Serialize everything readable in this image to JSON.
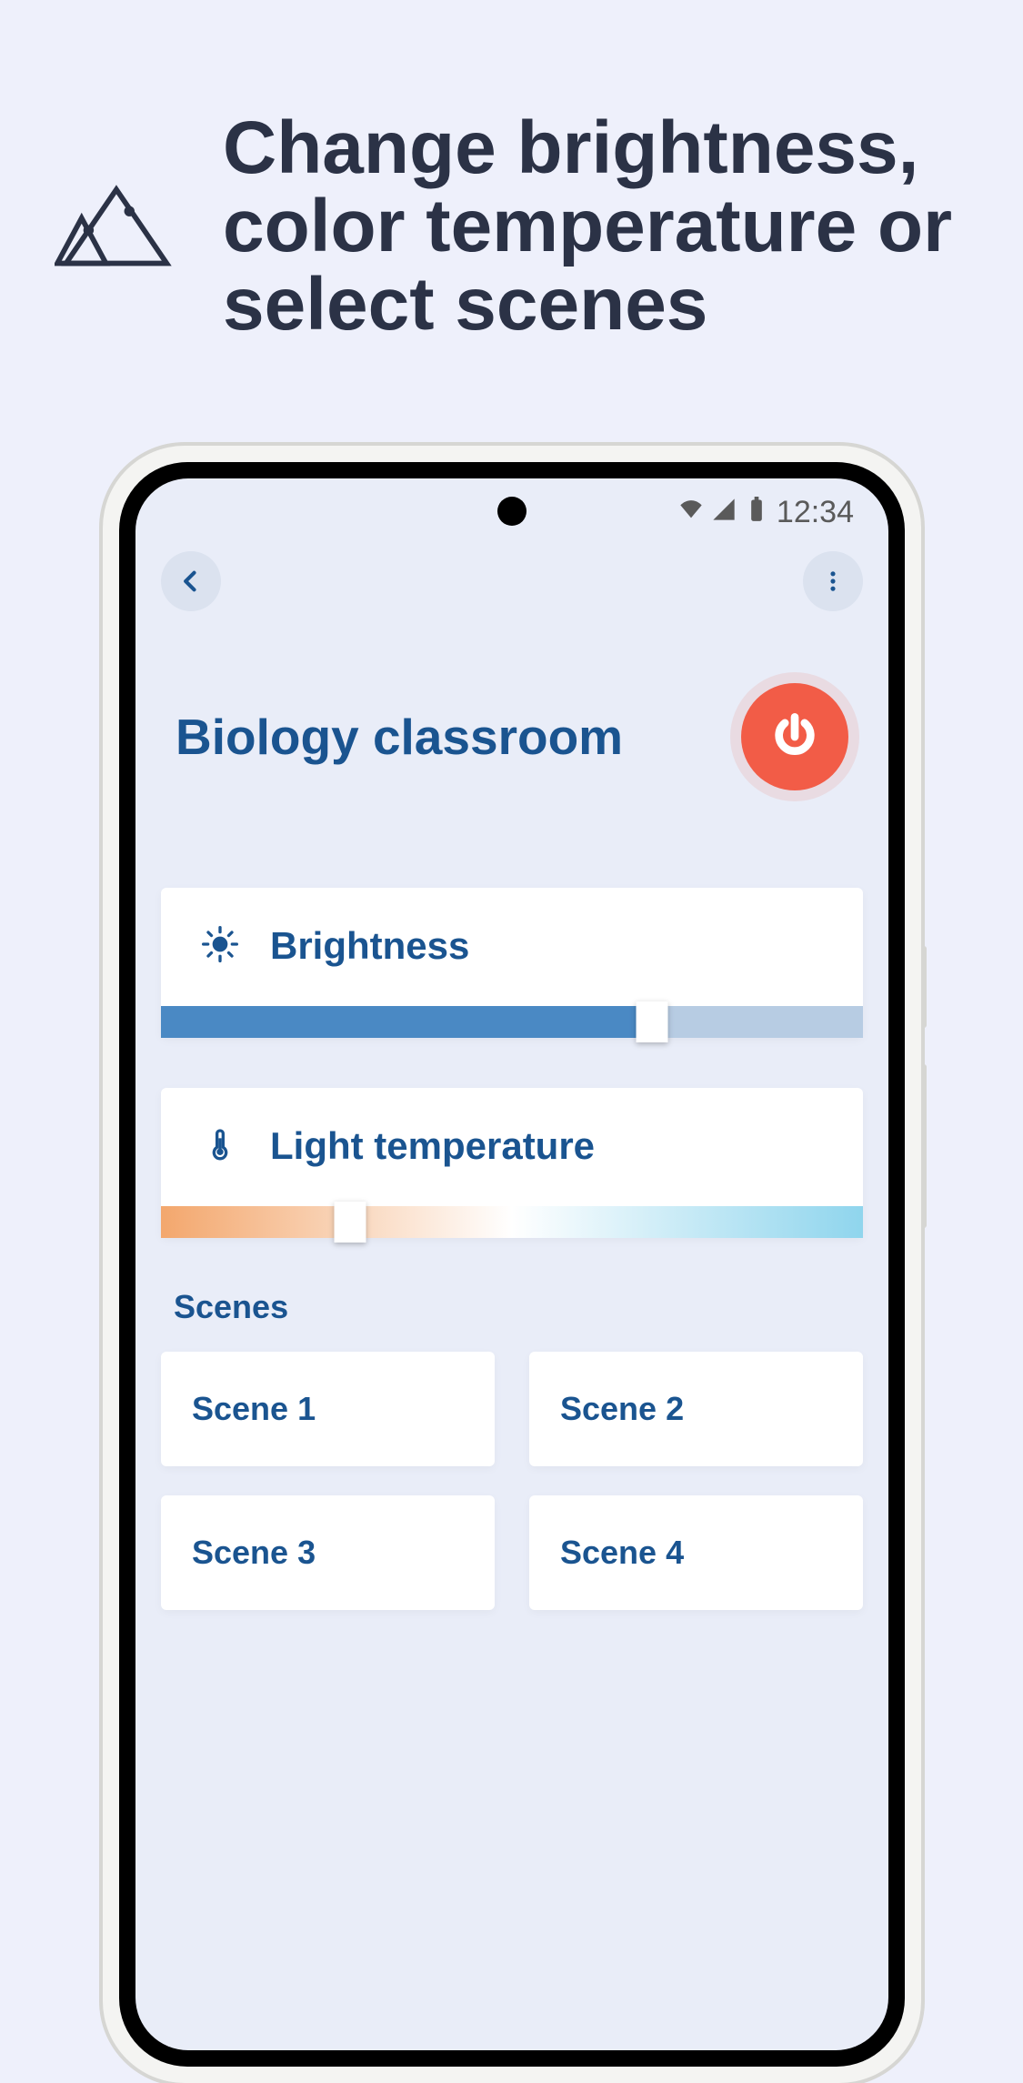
{
  "marketing": {
    "headline": "Change brightness, color temperature or select scenes"
  },
  "statusbar": {
    "time": "12:34"
  },
  "screen": {
    "room_title": "Biology classroom",
    "brightness": {
      "label": "Brightness",
      "value_pct": 70
    },
    "temperature": {
      "label": "Light temperature",
      "value_pct": 27
    },
    "scenes_label": "Scenes",
    "scenes": [
      {
        "label": "Scene 1"
      },
      {
        "label": "Scene 2"
      },
      {
        "label": "Scene 3"
      },
      {
        "label": "Scene 4"
      }
    ]
  },
  "colors": {
    "accent": "#1a5490",
    "power": "#f25c47",
    "page_bg": "#eef0fb",
    "screen_bg": "#e9edf8"
  }
}
